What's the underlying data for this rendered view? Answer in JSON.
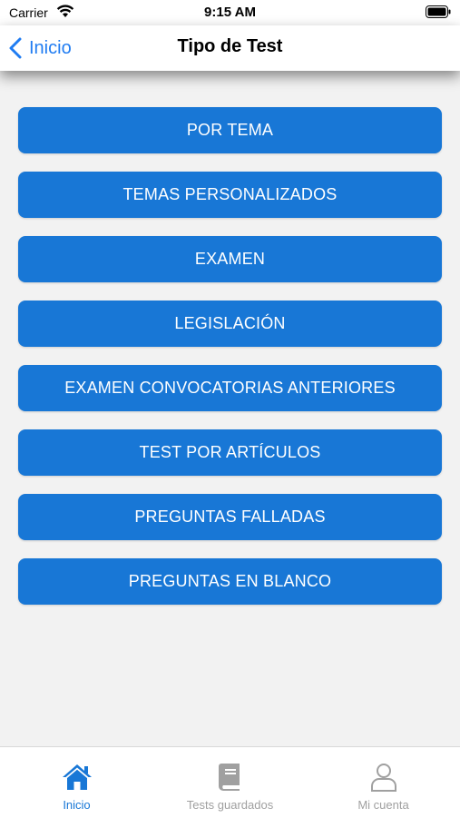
{
  "status_bar": {
    "carrier": "Carrier",
    "time": "9:15 AM"
  },
  "nav": {
    "back_label": "Inicio",
    "title": "Tipo de Test"
  },
  "menu": {
    "items": [
      {
        "label": "POR TEMA"
      },
      {
        "label": "TEMAS PERSONALIZADOS"
      },
      {
        "label": "EXAMEN"
      },
      {
        "label": "LEGISLACIÓN"
      },
      {
        "label": "EXAMEN CONVOCATORIAS ANTERIORES"
      },
      {
        "label": "TEST POR ARTÍCULOS"
      },
      {
        "label": "PREGUNTAS FALLADAS"
      },
      {
        "label": "PREGUNTAS EN BLANCO"
      }
    ]
  },
  "tab_bar": {
    "tabs": [
      {
        "label": "Inicio",
        "icon": "home-icon",
        "active": true
      },
      {
        "label": "Tests guardados",
        "icon": "book-icon",
        "active": false
      },
      {
        "label": "Mi cuenta",
        "icon": "user-icon",
        "active": false
      }
    ]
  },
  "colors": {
    "accent": "#1877d6",
    "back_link": "#1f7cf2",
    "inactive_tab": "#a0a0a0",
    "background": "#f2f2f2"
  }
}
